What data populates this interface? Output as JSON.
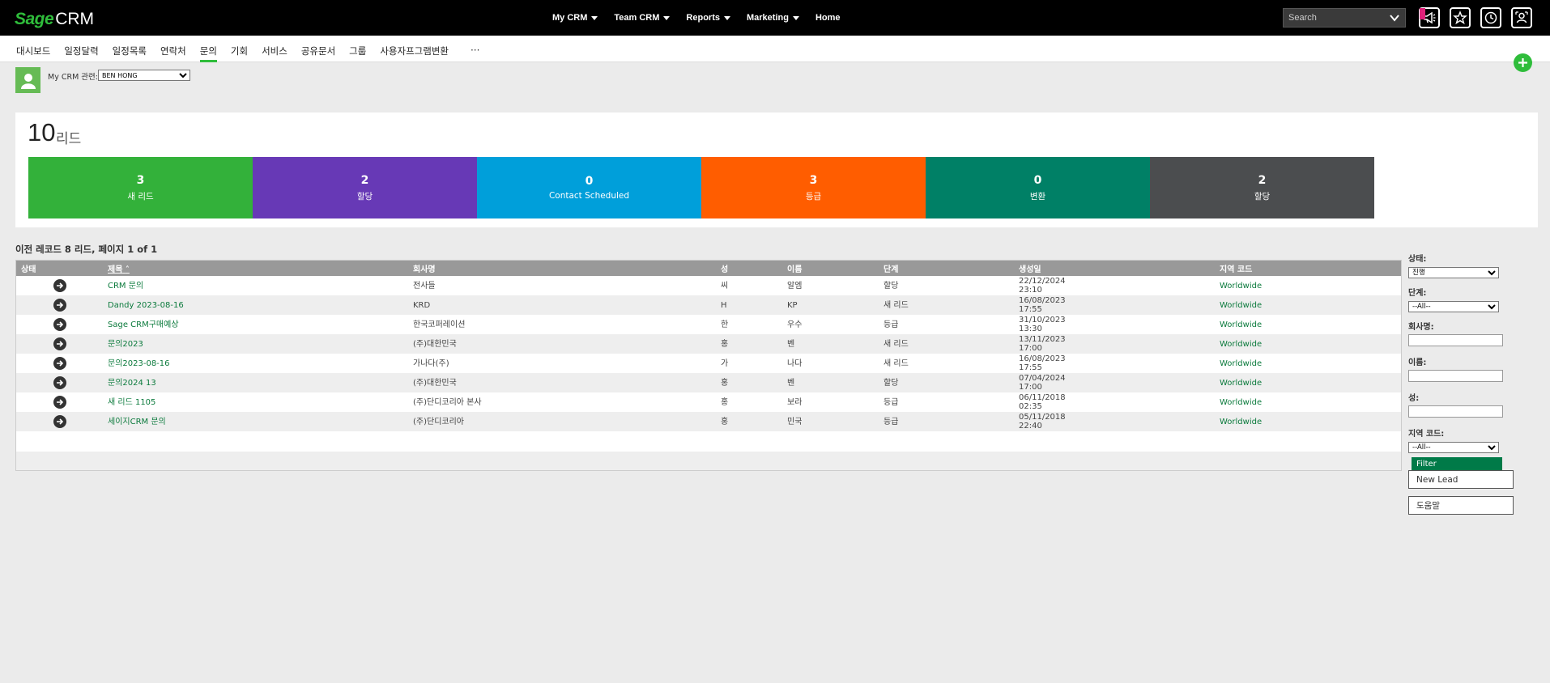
{
  "app": {
    "logo_sage": "Sage",
    "logo_crm": "CRM"
  },
  "topnav": [
    {
      "label": "My CRM",
      "has_caret": true
    },
    {
      "label": "Team CRM",
      "has_caret": true
    },
    {
      "label": "Reports",
      "has_caret": true
    },
    {
      "label": "Marketing",
      "has_caret": true
    },
    {
      "label": "Home",
      "has_caret": false
    }
  ],
  "search": {
    "placeholder": "Search"
  },
  "topicons": [
    "megaphone-icon",
    "star-icon",
    "recent-history-icon",
    "user-profile-icon"
  ],
  "subnav": {
    "items": [
      "대시보드",
      "일정달력",
      "일정목록",
      "연락처",
      "문의",
      "기회",
      "서비스",
      "공유문서",
      "그룹",
      "사용자프그램변환"
    ],
    "active_index": 4,
    "more": "···"
  },
  "context": {
    "label": "My CRM 관련:",
    "selected_user": "BEN HONG"
  },
  "summary": {
    "count": "10",
    "unit": "리드",
    "tiles": [
      {
        "num": "3",
        "label": "새 리드",
        "color": "#33b13a"
      },
      {
        "num": "2",
        "label": "할당",
        "color": "#6739b6"
      },
      {
        "num": "0",
        "label": "Contact Scheduled",
        "color": "#009fda"
      },
      {
        "num": "3",
        "label": "등급",
        "color": "#ff5d00"
      },
      {
        "num": "0",
        "label": "변환",
        "color": "#008066"
      },
      {
        "num": "2",
        "label": "할당",
        "color": "#4b4d4f"
      }
    ]
  },
  "list": {
    "title": "이전 레코드 8 리드, 페이지 1 of 1",
    "columns": [
      "상태",
      "제목",
      "회사명",
      "성",
      "이름",
      "단계",
      "생성일",
      "지역 코드"
    ],
    "sort_indicator": "˄",
    "rows": [
      {
        "title": "CRM 문의",
        "company": "전사들",
        "last": "씨",
        "first": "알엠",
        "stage": "할당",
        "date": "22/12/2024",
        "time": "23:10",
        "region": "Worldwide"
      },
      {
        "title": "Dandy 2023-08-16",
        "company": "KRD",
        "last": "H",
        "first": "KP",
        "stage": "새 리드",
        "date": "16/08/2023",
        "time": "17:55",
        "region": "Worldwide"
      },
      {
        "title": "Sage CRM구매예상",
        "company": "한국코퍼레이션",
        "last": "한",
        "first": "우수",
        "stage": "등급",
        "date": "31/10/2023",
        "time": "13:30",
        "region": "Worldwide"
      },
      {
        "title": "문의2023",
        "company": "(주)대한민국",
        "last": "홍",
        "first": "벤",
        "stage": "새 리드",
        "date": "13/11/2023",
        "time": "17:00",
        "region": "Worldwide"
      },
      {
        "title": "문의2023-08-16",
        "company": "가나다(주)",
        "last": "가",
        "first": "나다",
        "stage": "새 리드",
        "date": "16/08/2023",
        "time": "17:55",
        "region": "Worldwide"
      },
      {
        "title": "문의2024 13",
        "company": "(주)대한민국",
        "last": "홍",
        "first": "벤",
        "stage": "할당",
        "date": "07/04/2024",
        "time": "17:00",
        "region": "Worldwide"
      },
      {
        "title": "새 리드 1105",
        "company": "(주)단디코리아 본사",
        "last": "홍",
        "first": "보라",
        "stage": "등급",
        "date": "06/11/2018",
        "time": "02:35",
        "region": "Worldwide"
      },
      {
        "title": "세이지CRM 문의",
        "company": "(주)단디코리아",
        "last": "홍",
        "first": "민국",
        "stage": "등급",
        "date": "05/11/2018",
        "time": "22:40",
        "region": "Worldwide"
      }
    ]
  },
  "filter": {
    "status_label": "상태:",
    "status_value": "진행",
    "stage_label": "단계:",
    "stage_value": "--All--",
    "company_label": "회사명:",
    "first_label": "이름:",
    "last_label": "성:",
    "region_label": "지역 코드:",
    "region_value": "--All--",
    "filter_button": "Filter"
  },
  "actions": {
    "new_lead": "New Lead",
    "help": "도움말"
  }
}
